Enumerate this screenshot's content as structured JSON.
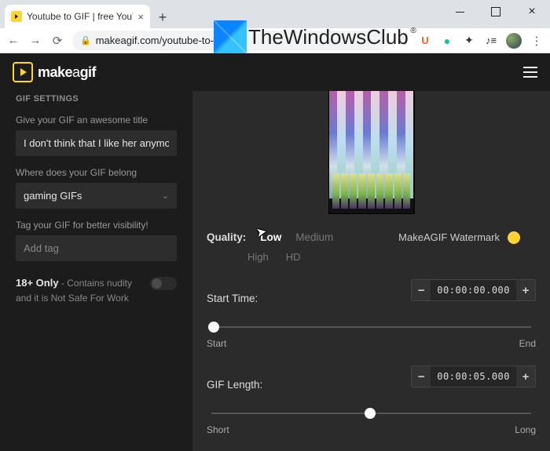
{
  "browser": {
    "tab_title": "Youtube to GIF | free YouTube to",
    "url": "makeagif.com/youtube-to-gif",
    "overlay_brand": "TheWindowsClub"
  },
  "header": {
    "brand_make": "make",
    "brand_a": "a",
    "brand_gif": "gif"
  },
  "sidebar": {
    "heading": "GIF SETTINGS",
    "title_label": "Give your GIF an awesome title",
    "title_value": "I don't think that I like her anymore",
    "category_label": "Where does your GIF belong",
    "category_value": "gaming GIFs",
    "tags_label": "Tag your GIF for better visibility!",
    "tags_placeholder": "Add tag",
    "adult_bold": "18+ Only",
    "adult_rest": " - Contains nudity and it is Not Safe For Work"
  },
  "main": {
    "quality_label": "Quality:",
    "quality_options": {
      "low": "Low",
      "medium": "Medium",
      "high": "High",
      "hd": "HD"
    },
    "watermark_label": "MakeAGIF Watermark",
    "start_time_label": "Start Time:",
    "start_time_value": "00:00:00.000",
    "start_slider": {
      "left": "Start",
      "right": "End"
    },
    "gif_length_label": "GIF Length:",
    "gif_length_value": "00:00:05.000",
    "length_slider": {
      "left": "Short",
      "right": "Long"
    }
  }
}
